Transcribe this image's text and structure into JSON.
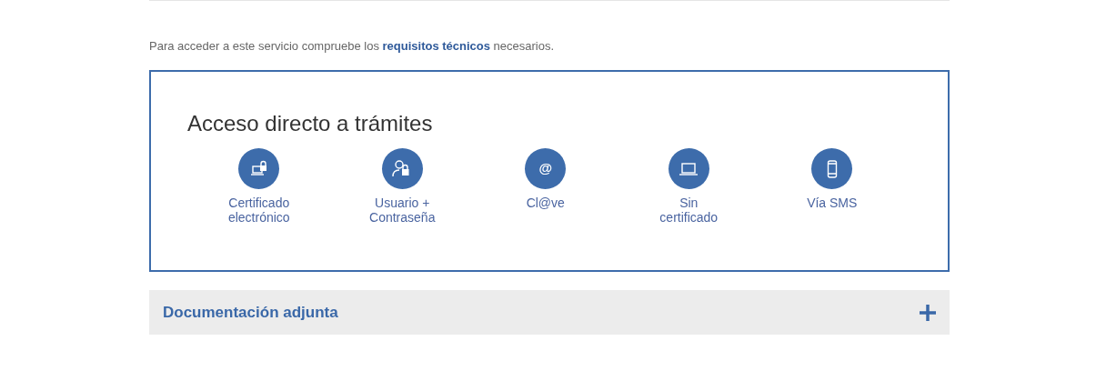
{
  "notice": {
    "before": "Para acceder a este servicio compruebe los ",
    "link": "requisitos técnicos",
    "after": " necesarios."
  },
  "access_panel": {
    "title": "Acceso directo a trámites",
    "options": [
      {
        "kind": "certificate",
        "label": "Certificado electrónico"
      },
      {
        "kind": "user-password",
        "label": "Usuario + Contraseña"
      },
      {
        "kind": "at",
        "glyph": "@",
        "label": "Cl@ve"
      },
      {
        "kind": "laptop",
        "label": "Sin certificado"
      },
      {
        "kind": "phone",
        "label": "Vía SMS"
      }
    ]
  },
  "accordion": {
    "title": "Documentación adjunta",
    "expanded": false
  }
}
